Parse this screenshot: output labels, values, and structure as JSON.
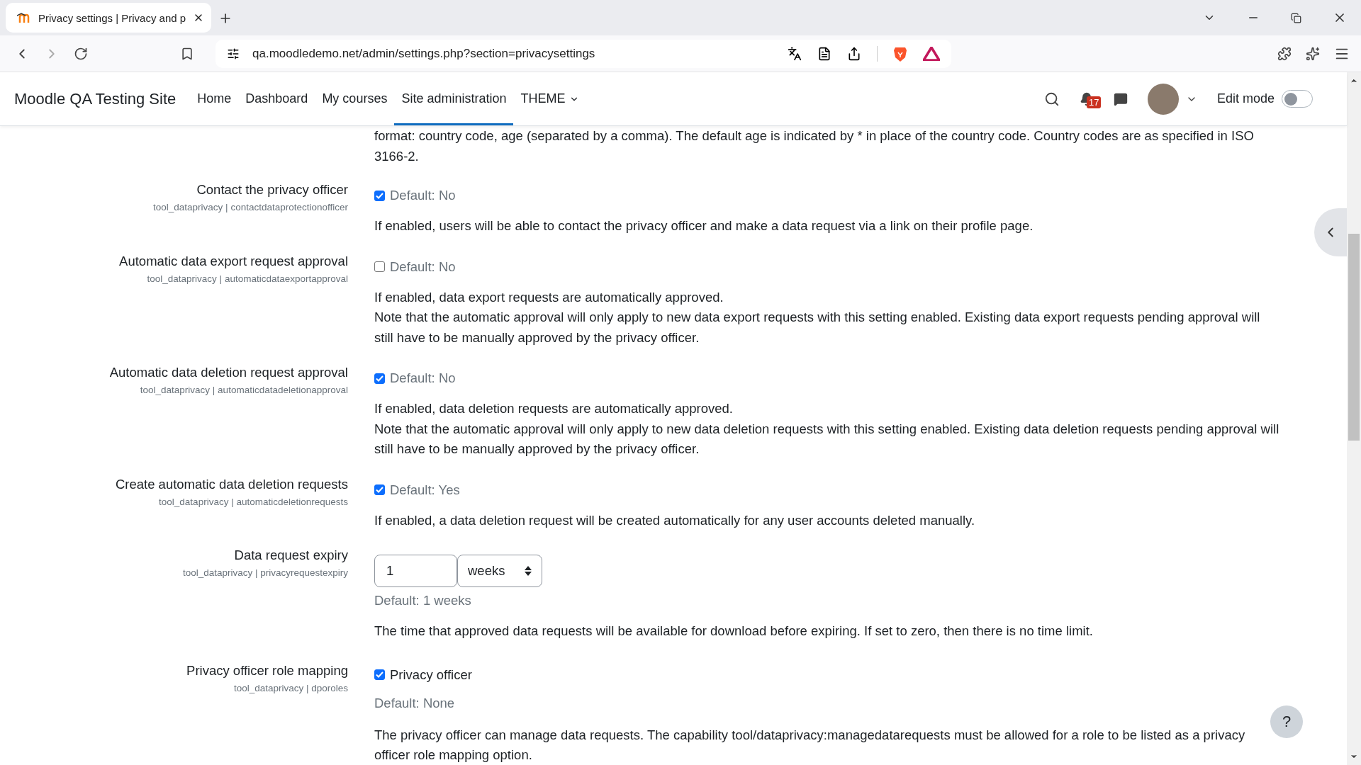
{
  "browser": {
    "tabs": [
      {
        "title": "Privacy settings | Privacy and p",
        "selected": true
      }
    ],
    "url": "qa.moodledemo.net/admin/settings.php?section=privacysettings"
  },
  "navbar": {
    "site_name": "Moodle QA Testing Site",
    "items": [
      {
        "label": "Home",
        "selected": false,
        "dropdown": false
      },
      {
        "label": "Dashboard",
        "selected": false,
        "dropdown": false
      },
      {
        "label": "My courses",
        "selected": false,
        "dropdown": false
      },
      {
        "label": "Site administration",
        "selected": true,
        "dropdown": false
      },
      {
        "label": "THEME",
        "selected": false,
        "dropdown": true
      }
    ],
    "notification_count": "17",
    "edit_mode": {
      "label": "Edit mode",
      "on": false
    }
  },
  "intro_text": "format: country code, age (separated by a comma). The default age is indicated by * in place of the country code. Country codes are as specified in ISO 3166-2.",
  "settings": [
    {
      "kind": "checkbox",
      "label": "Contact the privacy officer",
      "name": "tool_dataprivacy | contactdataprotectionofficer",
      "checked": true,
      "default": "Default: No",
      "description": [
        "If enabled, users will be able to contact the privacy officer and make a data request via a link on their profile page."
      ]
    },
    {
      "kind": "checkbox",
      "label": "Automatic data export request approval",
      "name": "tool_dataprivacy | automaticdataexportapproval",
      "checked": false,
      "default": "Default: No",
      "description": [
        "If enabled, data export requests are automatically approved.",
        "Note that the automatic approval will only apply to new data export requests with this setting enabled. Existing data export requests pending approval will still have to be manually approved by the privacy officer."
      ]
    },
    {
      "kind": "checkbox",
      "label": "Automatic data deletion request approval",
      "name": "tool_dataprivacy | automaticdatadeletionapproval",
      "checked": true,
      "default": "Default: No",
      "description": [
        "If enabled, data deletion requests are automatically approved.",
        "Note that the automatic approval will only apply to new data deletion requests with this setting enabled. Existing data deletion requests pending approval will still have to be manually approved by the privacy officer."
      ]
    },
    {
      "kind": "checkbox",
      "label": "Create automatic data deletion requests",
      "name": "tool_dataprivacy | automaticdeletionrequests",
      "checked": true,
      "default": "Default: Yes",
      "description": [
        "If enabled, a data deletion request will be created automatically for any user accounts deleted manually."
      ]
    },
    {
      "kind": "duration",
      "label": "Data request expiry",
      "name": "tool_dataprivacy | privacyrequestexpiry",
      "value": "1",
      "unit": "weeks",
      "default": "Default: 1 weeks",
      "description": [
        "The time that approved data requests will be available for download before expiring. If set to zero, then there is no time limit."
      ]
    },
    {
      "kind": "multicheckbox",
      "label": "Privacy officer role mapping",
      "name": "tool_dataprivacy | dporoles",
      "options": [
        {
          "label": "Privacy officer",
          "checked": true
        }
      ],
      "default": "Default: None",
      "description": [
        "The privacy officer can manage data requests. The capability tool/dataprivacy:managedatarequests must be allowed for a role to be listed as a privacy officer role mapping option."
      ]
    }
  ],
  "help_button": "?"
}
